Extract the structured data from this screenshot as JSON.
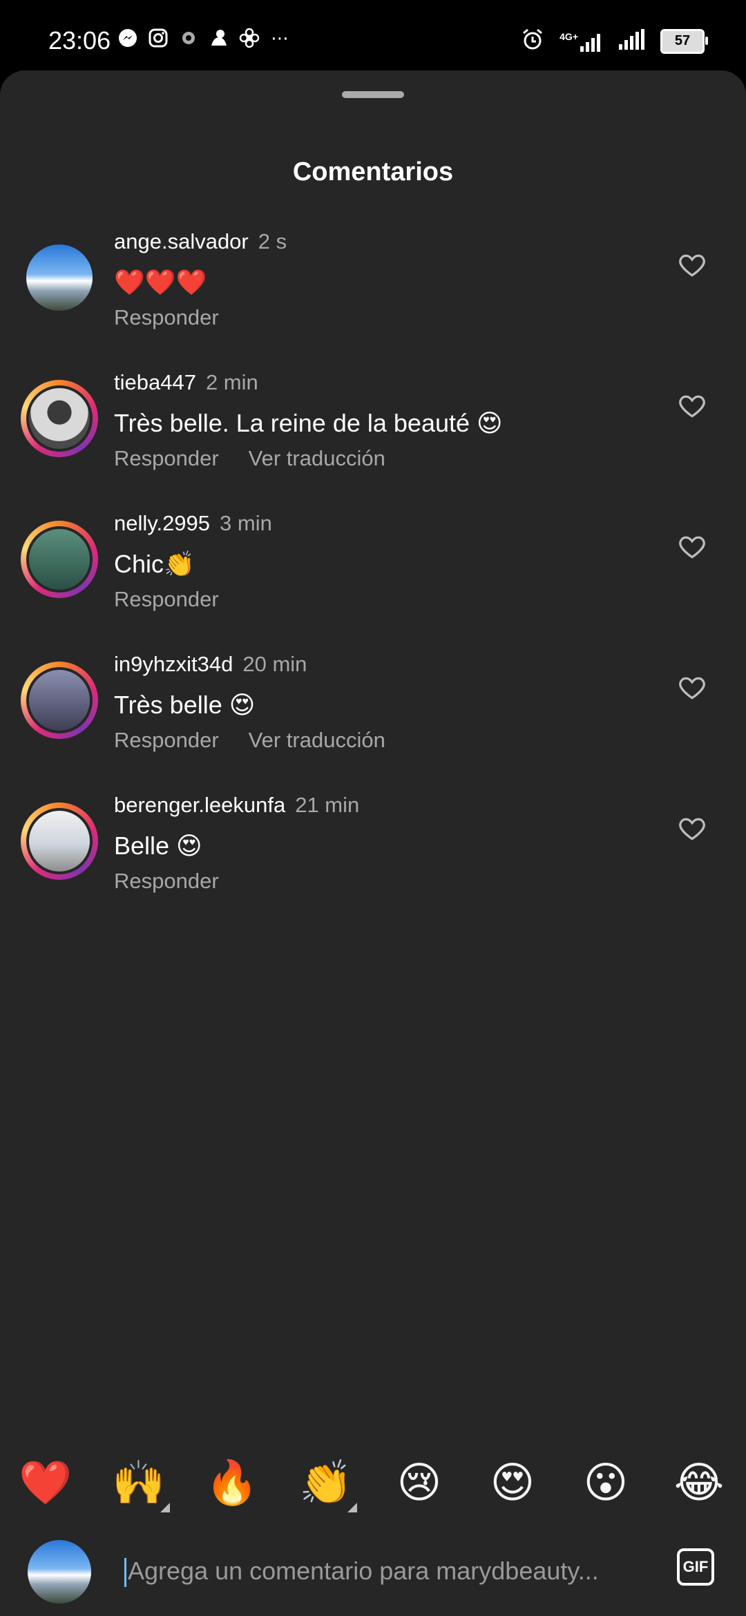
{
  "status_bar": {
    "time": "23:06",
    "left_icons": [
      "messenger-icon",
      "instagram-icon",
      "settings-icon",
      "app-icon",
      "pinwheel-icon",
      "more-icon"
    ],
    "network": "4G+",
    "battery": "57"
  },
  "header": {
    "title": "Comentarios"
  },
  "comments": [
    {
      "user": "ange.salvador",
      "time": "2 s",
      "text": "❤️❤️❤️",
      "actions": [
        "Responder"
      ]
    },
    {
      "user": "tieba447",
      "time": "2 min",
      "text": "Très belle. La reine de la beauté 😍",
      "actions": [
        "Responder",
        "Ver traducción"
      ]
    },
    {
      "user": "nelly.2995",
      "time": "3 min",
      "text": "Chic👏",
      "actions": [
        "Responder"
      ]
    },
    {
      "user": "in9yhzxit34d",
      "time": "20 min",
      "text": "Très belle 😍",
      "actions": [
        "Responder",
        "Ver traducción"
      ]
    },
    {
      "user": "berenger.leekunfa",
      "time": "21 min",
      "text": "Belle 😍",
      "actions": [
        "Responder"
      ]
    }
  ],
  "emoji_bar": [
    "❤️",
    "🙌",
    "🔥",
    "👏",
    "😢",
    "😍",
    "😮",
    "😂"
  ],
  "input": {
    "placeholder": "Agrega un comentario para marydbeauty...",
    "gif_label": "GIF"
  },
  "colors": {
    "sheet_bg": "#262626",
    "text": "#ffffff",
    "muted": "#a8a8a8",
    "accent_cursor": "#6ec3ff"
  }
}
